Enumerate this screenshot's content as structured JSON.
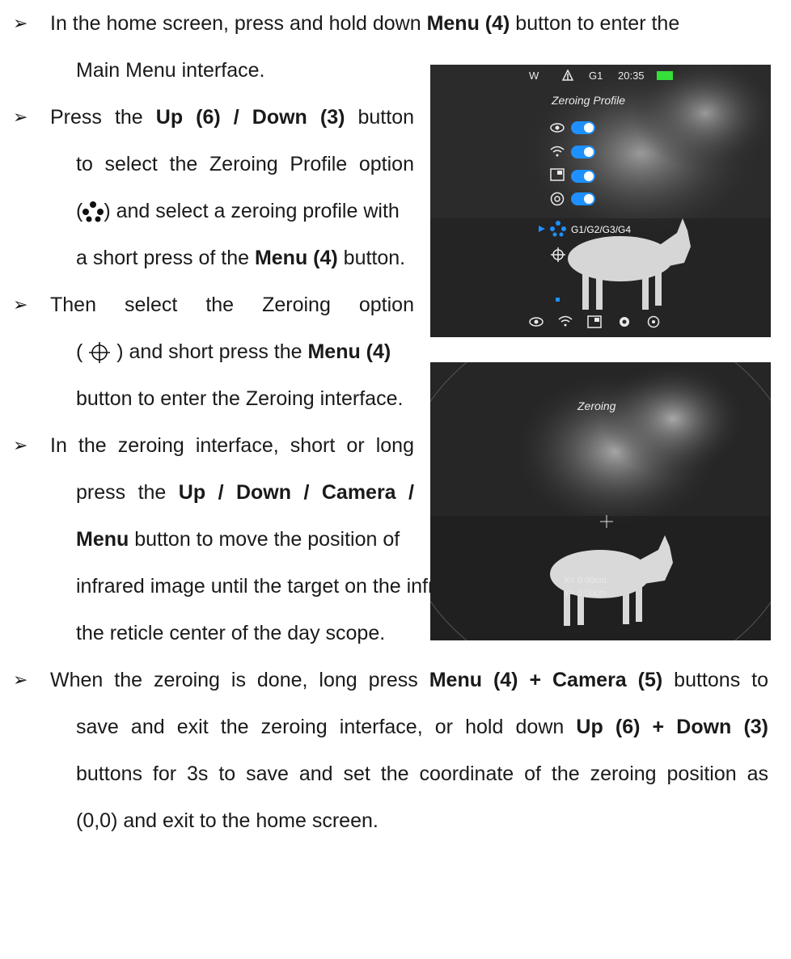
{
  "bullets": [
    "➢",
    "➢",
    "➢",
    "➢",
    "➢"
  ],
  "p1": {
    "l1a": "In the home screen, press and hold down ",
    "l1b": "Menu (4)",
    "l1c": " button to enter the",
    "l2": "Main Menu interface."
  },
  "p2": {
    "l1a": "Press the ",
    "l1b": "Up (6) / Down (3)",
    "l1c": " button",
    "l2": "to select the Zeroing Profile option",
    "l3a": "(",
    "l3b": ") and select a zeroing profile with",
    "l4a": "a short press of the ",
    "l4b": "Menu (4)",
    "l4c": " button."
  },
  "p3": {
    "l1": "Then select the Zeroing option",
    "l2a": "(",
    "l2b": ") and short press the ",
    "l2c": "Menu (4)",
    "l3": "button to enter the Zeroing interface."
  },
  "p4": {
    "l1": "In the zeroing interface, short or long",
    "l2a": "press the ",
    "l2b": "Up / Down / Camera /",
    "l3a": "Menu",
    "l3b": " button to move the position of",
    "l4": "infrared image until the target on the infrared image is consistency with",
    "l5": "the reticle center of the day scope."
  },
  "p5": {
    "l1a": "When the zeroing is done, long press ",
    "l1b": "Menu (4) + Camera (5)",
    "l1c": " buttons to",
    "l2a": "save and exit the zeroing interface, or hold down ",
    "l2b": "Up (6) + Down (3)",
    "l3": "buttons for 3s to save and set the coordinate of the zeroing position as",
    "l4": "(0,0) and exit to the home screen."
  },
  "screen1": {
    "status_w": "W",
    "status_g": "G1",
    "status_time": "20:35",
    "menu_title": "Zeroing Profile",
    "profile_options": "G1/G2/G3/G4"
  },
  "screen2": {
    "title": "Zeroing",
    "x_readout": "X= 0.00cm",
    "y_readout": "Y= 0.00cm"
  },
  "colors": {
    "accent": "#1e90ff",
    "battery": "#35e03a",
    "text": "#1a1a1a"
  }
}
